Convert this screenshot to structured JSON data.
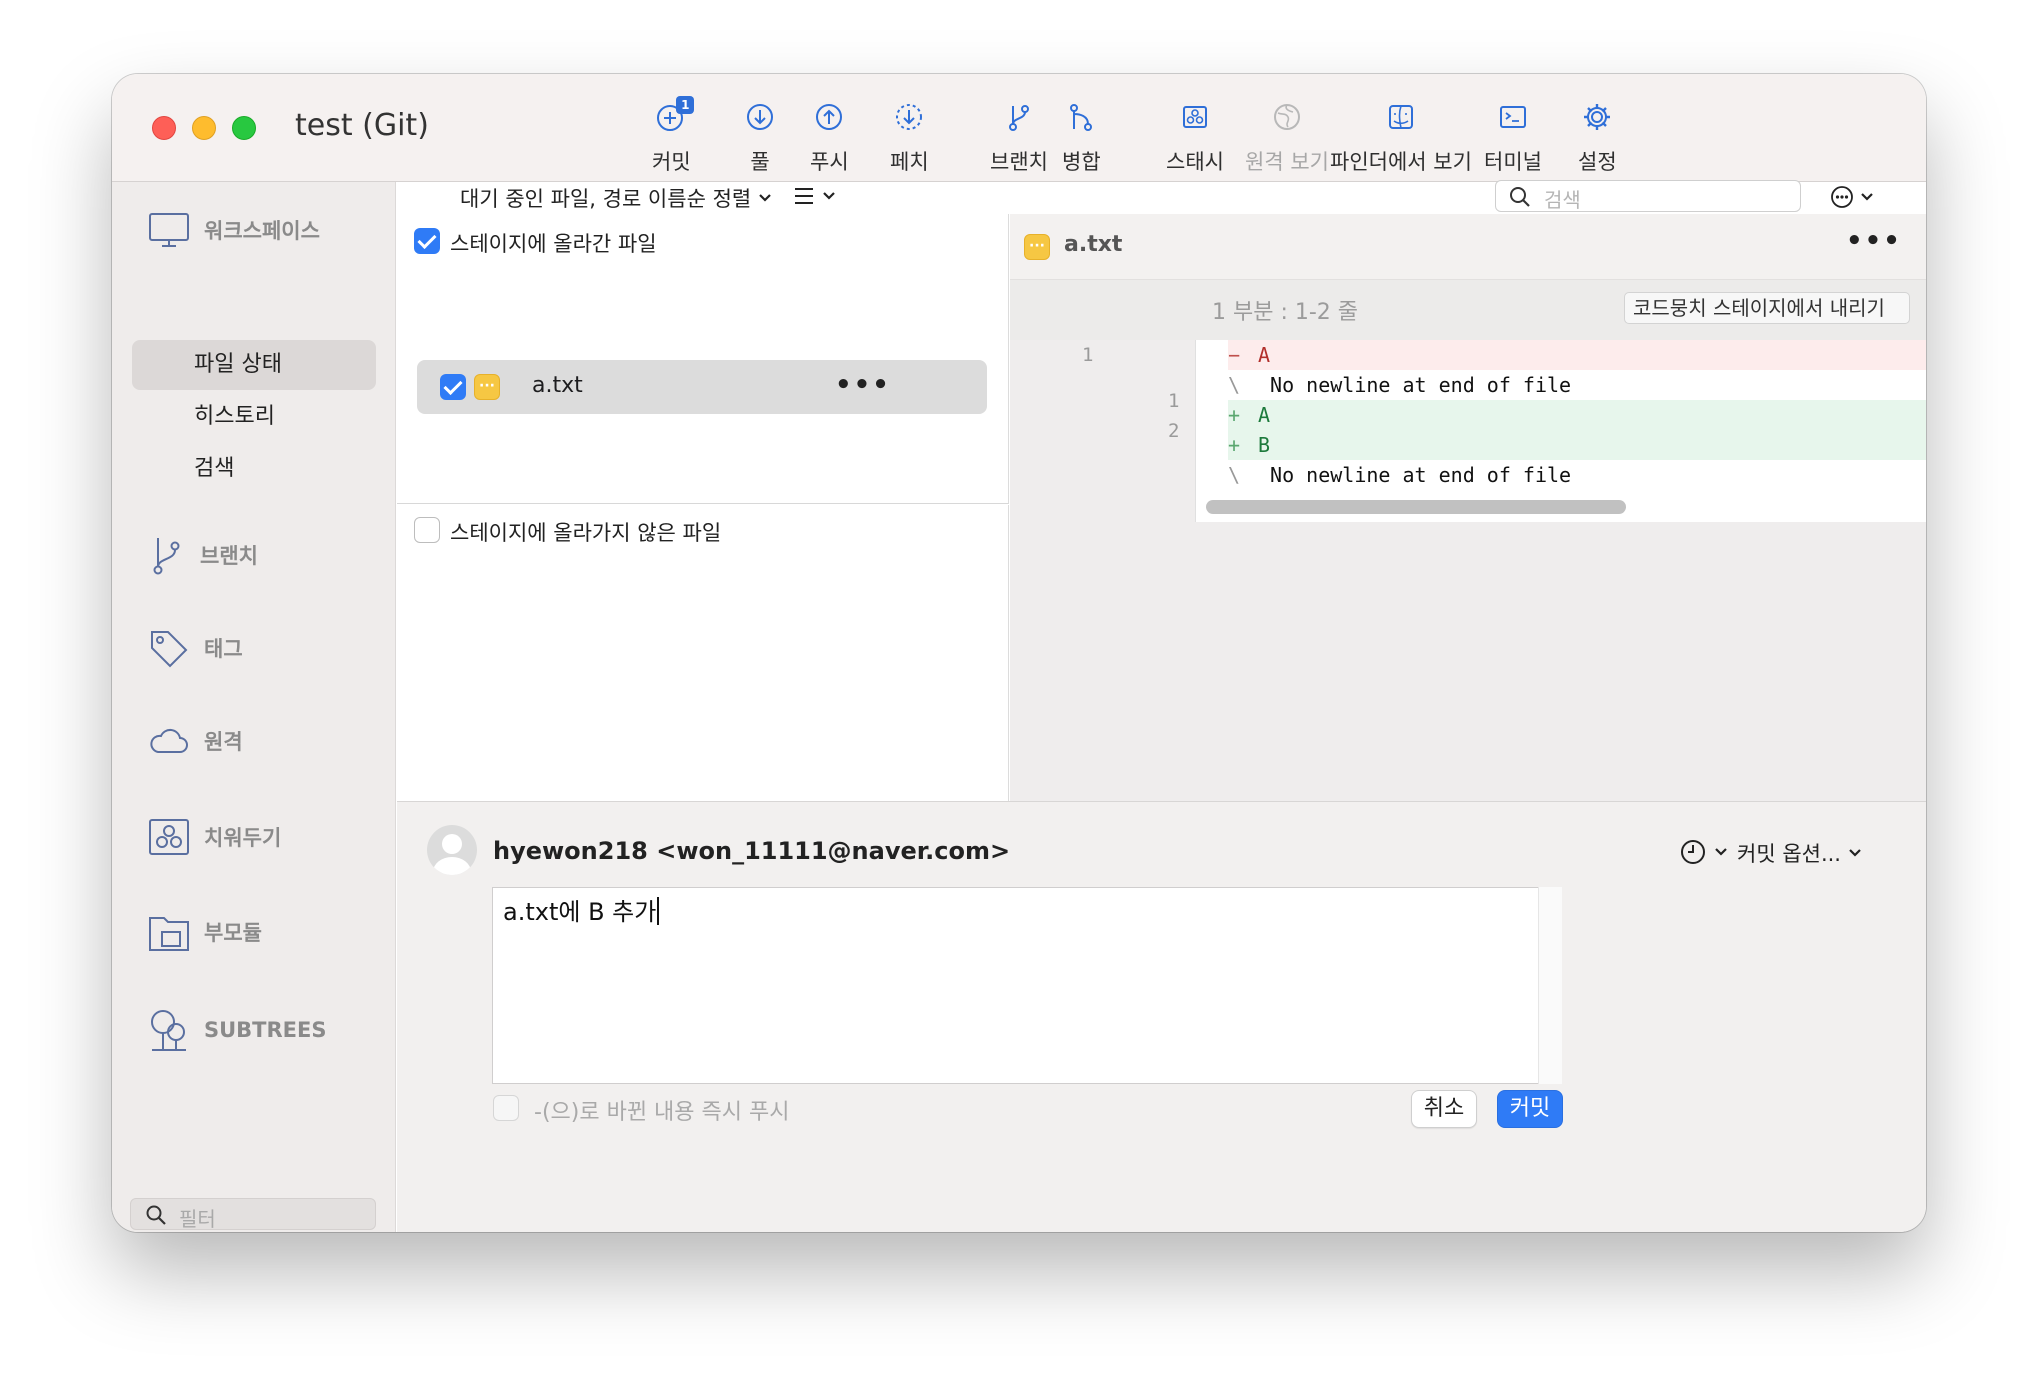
{
  "window": {
    "title": "test (Git)"
  },
  "toolbar": [
    {
      "id": "commit",
      "label": "커밋",
      "icon": "commit-plus-icon",
      "badge": "1",
      "disabled": false
    },
    {
      "id": "pull",
      "label": "풀",
      "icon": "pull-down-icon",
      "disabled": false
    },
    {
      "id": "push",
      "label": "푸시",
      "icon": "push-up-icon",
      "disabled": false
    },
    {
      "id": "fetch",
      "label": "페치",
      "icon": "fetch-icon",
      "disabled": false
    },
    {
      "id": "branch",
      "label": "브랜치",
      "icon": "branch-icon",
      "disabled": false
    },
    {
      "id": "merge",
      "label": "병합",
      "icon": "merge-icon",
      "disabled": false
    },
    {
      "id": "stash",
      "label": "스태시",
      "icon": "stash-icon",
      "disabled": false
    },
    {
      "id": "remote_view",
      "label": "원격 보기",
      "icon": "globe-icon",
      "disabled": true
    },
    {
      "id": "finder",
      "label": "파인더에서 보기",
      "icon": "finder-icon",
      "disabled": false
    },
    {
      "id": "terminal",
      "label": "터미널",
      "icon": "terminal-icon",
      "disabled": false
    },
    {
      "id": "settings",
      "label": "설정",
      "icon": "gear-icon",
      "disabled": false
    }
  ],
  "sidebar": {
    "workspace_label": "워크스페이스",
    "items": [
      {
        "label": "파일 상태",
        "selected": true
      },
      {
        "label": "히스토리",
        "selected": false
      },
      {
        "label": "검색",
        "selected": false
      }
    ],
    "sections": [
      {
        "label": "브랜치",
        "icon": "branch-icon"
      },
      {
        "label": "태그",
        "icon": "tag-icon"
      },
      {
        "label": "원격",
        "icon": "cloud-icon"
      },
      {
        "label": "치워두기",
        "icon": "stash-icon"
      },
      {
        "label": "부모듈",
        "icon": "submodule-icon"
      },
      {
        "label": "SUBTREES",
        "icon": "subtree-icon"
      }
    ],
    "filter_placeholder": "필터"
  },
  "filelist": {
    "sort_label": "대기 중인 파일, 경로 이름순 정렬",
    "search_placeholder": "검색",
    "staged_title": "스테이지에 올라간 파일",
    "staged_files": [
      {
        "name": "a.txt",
        "status": "modified",
        "checked": true
      }
    ],
    "unstaged_title": "스테이지에 올라가지 않은 파일"
  },
  "diff": {
    "file": "a.txt",
    "hunk_label": "1 부분 : 1-2 줄",
    "hunk_button": "코드뭉치 스테이지에서 내리기",
    "lines": [
      {
        "type": "del",
        "old": "1",
        "new": "",
        "marker": "−",
        "text": "A"
      },
      {
        "type": "ctx",
        "old": "",
        "new": "",
        "marker": "\\",
        "text": " No newline at end of file"
      },
      {
        "type": "add",
        "old": "",
        "new": "1",
        "marker": "+",
        "text": "A"
      },
      {
        "type": "add",
        "old": "",
        "new": "2",
        "marker": "+",
        "text": "B"
      },
      {
        "type": "ctx",
        "old": "",
        "new": "",
        "marker": "\\",
        "text": " No newline at end of file"
      }
    ]
  },
  "commit": {
    "author": "hyewon218 <won_11111@naver.com>",
    "options_label": "커밋 옵션...",
    "message": "a.txt에 B 추가",
    "push_label": "-(으)로 바뀐 내용 즉시 푸시",
    "cancel_label": "취소",
    "commit_label": "커밋"
  },
  "colors": {
    "accent": "#2f7bf6",
    "del_bg": "#fdecec",
    "add_bg": "#e7f6ec",
    "modified_badge": "#f6c743"
  }
}
